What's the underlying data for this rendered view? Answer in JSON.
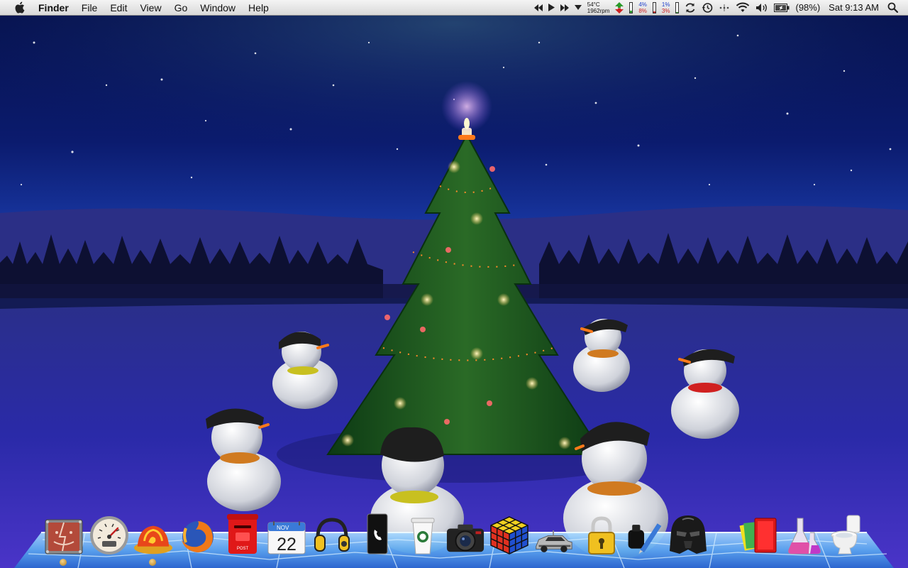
{
  "menubar": {
    "app_name": "Finder",
    "menus": [
      "File",
      "Edit",
      "View",
      "Go",
      "Window",
      "Help"
    ],
    "status": {
      "temp": "54°C",
      "fan": "1962rpm",
      "cpu_user": "4%",
      "cpu_sys": "8%",
      "net_in": "1%",
      "net_out": "3%",
      "battery": "(98%)",
      "battery_level": 0.98,
      "clock": "Sat 9:13 AM"
    },
    "status_icons": [
      "media-previous-icon",
      "media-play-icon",
      "media-next-icon",
      "media-dropdown-icon",
      "network-activity-icon",
      "sync-icon",
      "time-machine-icon",
      "bluetooth-dots-icon",
      "wifi-icon",
      "volume-icon",
      "battery-icon",
      "spotlight-icon"
    ]
  },
  "desktop": {
    "wallpaper": "christmas-tree-snowmen-night"
  },
  "dock": {
    "items": [
      {
        "id": "finder",
        "icon": "finder-icon",
        "running": true
      },
      {
        "id": "dashboard",
        "icon": "speedometer-dashboard-icon",
        "running": false
      },
      {
        "id": "safari",
        "icon": "fire-helmet-browser-icon",
        "running": true
      },
      {
        "id": "firefox",
        "icon": "firefox-icon",
        "running": false
      },
      {
        "id": "mail",
        "icon": "red-postbox-mail-icon",
        "running": false
      },
      {
        "id": "ical",
        "icon": "calendar-icon",
        "running": false,
        "month": "NOV",
        "day": "22"
      },
      {
        "id": "itunes",
        "icon": "headphones-itunes-icon",
        "running": false
      },
      {
        "id": "phone",
        "icon": "phone-icon",
        "running": false
      },
      {
        "id": "cup",
        "icon": "coffee-cup-icon",
        "running": false
      },
      {
        "id": "camera",
        "icon": "camera-icon",
        "running": false
      },
      {
        "id": "rubiks",
        "icon": "rubiks-cube-icon",
        "running": false
      },
      {
        "id": "delorean",
        "icon": "delorean-car-icon",
        "running": false
      },
      {
        "id": "keychain",
        "icon": "padlock-icon",
        "running": false
      },
      {
        "id": "inkwell",
        "icon": "ink-pen-icon",
        "running": false
      },
      {
        "id": "vader",
        "icon": "darth-vader-icon",
        "running": false
      },
      {
        "id": "documents",
        "icon": "documents-folder-icon",
        "running": false
      },
      {
        "id": "chemistry",
        "icon": "chemistry-flask-icon",
        "running": false
      },
      {
        "id": "trash",
        "icon": "toilet-trash-icon",
        "running": false
      }
    ]
  }
}
